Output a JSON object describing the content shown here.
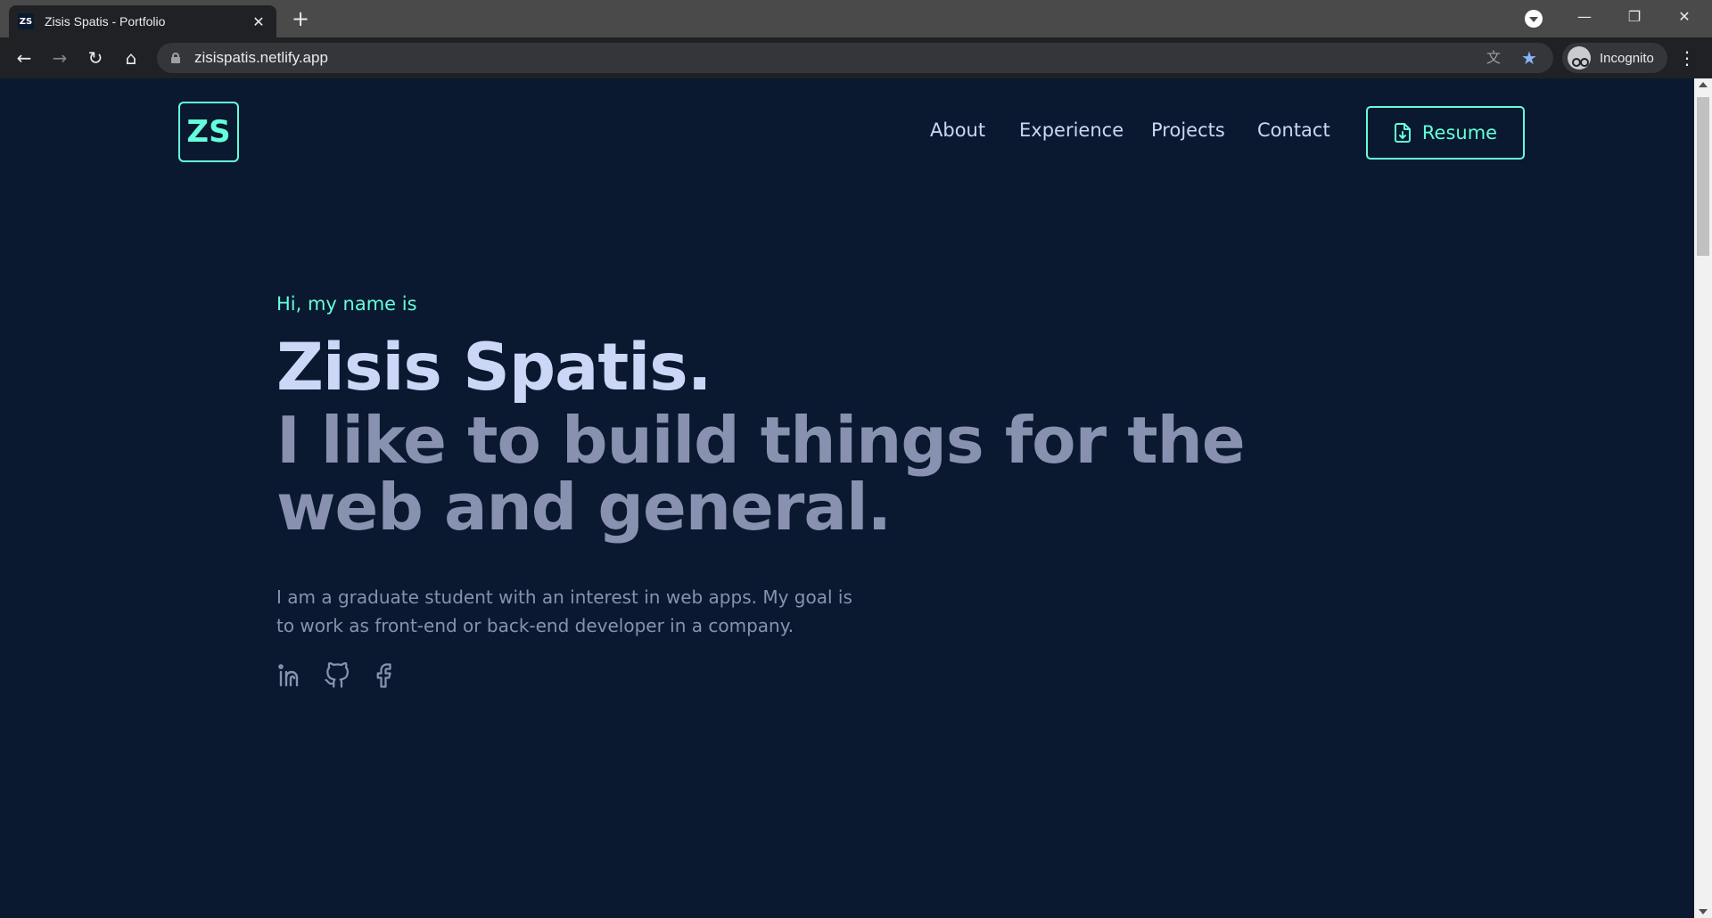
{
  "browser": {
    "tab_title": "Zisis Spatis - Portfolio",
    "tab_favicon_text": "ZS",
    "url": "zisispatis.netlify.app",
    "profile_label": "Incognito"
  },
  "page": {
    "logo_text": "ZS",
    "nav": {
      "about": "About",
      "experience": "Experience",
      "projects": "Projects",
      "contact": "Contact"
    },
    "resume_label": "Resume",
    "greeting": "Hi, my name is",
    "name": "Zisis Spatis.",
    "tagline": "I like to build things for the web and general.",
    "bio": "I am a graduate student with an interest in web apps. My goal is to work as front-end or back-end developer in a company.",
    "socials": [
      "linkedin-icon",
      "github-icon",
      "facebook-icon"
    ]
  },
  "colors": {
    "background": "#0a192f",
    "accent": "#64ffda",
    "heading": "#ccd6f6",
    "muted": "#8892b0"
  }
}
